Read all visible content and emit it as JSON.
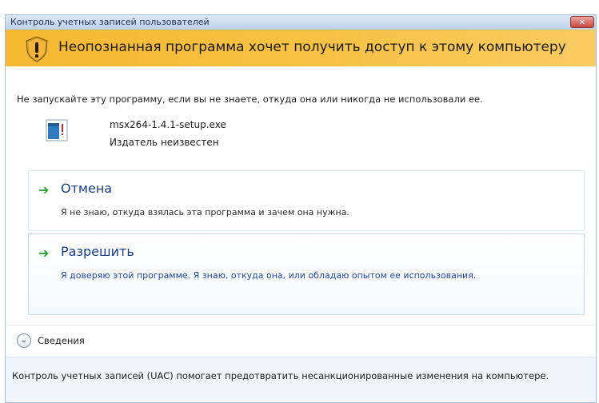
{
  "window": {
    "title": "Контроль учетных записей пользователей",
    "close_glyph": "✕"
  },
  "banner": {
    "text": "Неопознанная программа хочет получить доступ к этому компьютеру",
    "icon": "uac-shield-icon"
  },
  "warning_text": "Не запускайте эту программу, если вы не знаете, откуда она или никогда не использовали ее.",
  "program": {
    "file_name": "msx264-1.4.1-setup.exe",
    "publisher": "Издатель неизвестен",
    "icon": "executable-file-icon"
  },
  "options": [
    {
      "title": "Отмена",
      "description": "Я не знаю, откуда взялась эта программа и зачем она нужна."
    },
    {
      "title": "Разрешить",
      "description": "Я доверяю этой программе. Я знаю, откуда она, или обладаю опытом ее использования."
    }
  ],
  "arrow_glyph": "➔",
  "details": {
    "label": "Сведения",
    "glyph": "⌄"
  },
  "footer_text": "Контроль учетных записей (UAC) помогает предотвратить несанкционированные изменения на компьютере.",
  "colors": {
    "banner": "#f6b832",
    "option_title": "#1a3d8f",
    "arrow": "#2aa037",
    "allow_description": "#1f46b2"
  }
}
